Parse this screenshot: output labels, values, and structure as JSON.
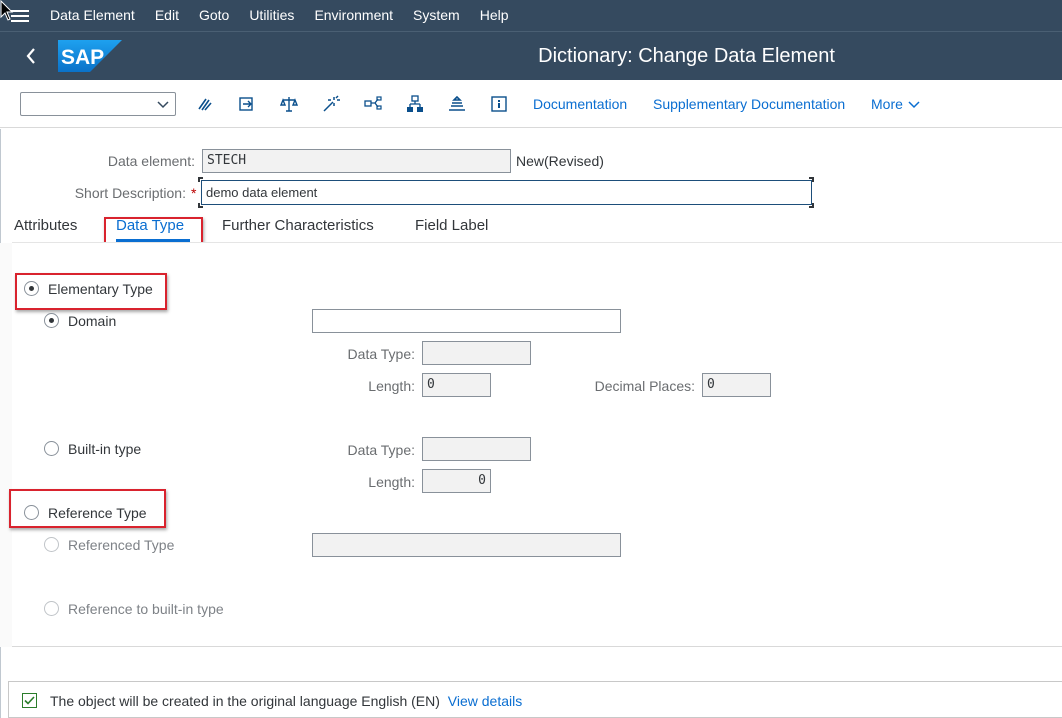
{
  "menu": {
    "items": [
      "Data Element",
      "Edit",
      "Goto",
      "Utilities",
      "Environment",
      "System",
      "Help"
    ]
  },
  "shell": {
    "logo_text": "SAP",
    "title": "Dictionary: Change Data Element"
  },
  "toolbar": {
    "command_value": "",
    "icons": [
      "other-object-icon",
      "display-change-icon",
      "check-icon",
      "activate-icon",
      "where-used-icon",
      "object-list-icon",
      "display-navigation-icon",
      "info-icon"
    ],
    "documentation": "Documentation",
    "supplementary_documentation": "Supplementary Documentation",
    "more": "More"
  },
  "header_form": {
    "data_element_label": "Data element:",
    "data_element_value": "STECH",
    "status": "New(Revised)",
    "short_description_label": "Short Description:",
    "required_mark": "*",
    "short_description_value": "demo data element"
  },
  "tabs": [
    {
      "label": "Attributes",
      "active": false
    },
    {
      "label": "Data Type",
      "active": true
    },
    {
      "label": "Further Characteristics",
      "active": false
    },
    {
      "label": "Field Label",
      "active": false
    }
  ],
  "data_type": {
    "elementary_type": {
      "label": "Elementary Type",
      "selected": true
    },
    "domain": {
      "label": "Domain",
      "selected": true,
      "value": ""
    },
    "domain_data_type_label": "Data Type:",
    "domain_data_type_value": "",
    "domain_length_label": "Length:",
    "domain_length_value": "0",
    "decimal_places_label": "Decimal Places:",
    "decimal_places_value": "0",
    "builtin": {
      "label": "Built-in type",
      "selected": false
    },
    "builtin_data_type_label": "Data Type:",
    "builtin_data_type_value": "",
    "builtin_length_label": "Length:",
    "builtin_length_value": "0",
    "reference_type": {
      "label": "Reference Type",
      "selected": false
    },
    "referenced_type": {
      "label": "Referenced Type",
      "selected": false,
      "value": ""
    },
    "reference_builtin": {
      "label": "Reference to built-in type",
      "selected": false
    }
  },
  "footer": {
    "message": "The object will be created in the original language English (EN)",
    "link": "View details",
    "checked": true
  },
  "colors": {
    "shell": "#354a5f",
    "link": "#0a6ed1",
    "highlight": "#d9232e"
  }
}
